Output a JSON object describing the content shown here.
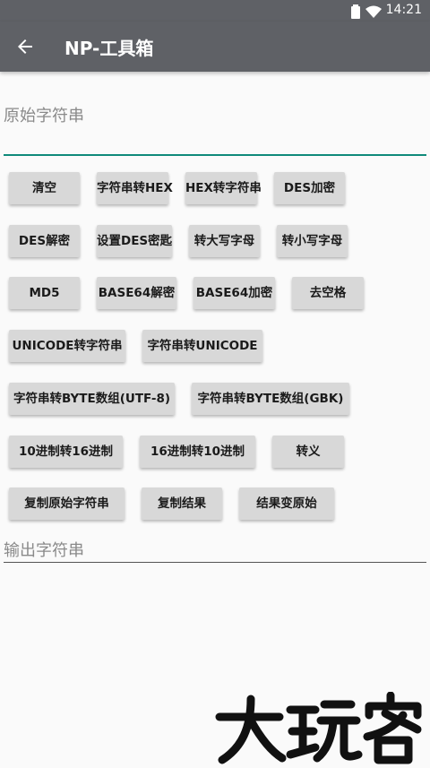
{
  "status_bar": {
    "time": "14:21",
    "icons": [
      "wifi-icon",
      "battery-icon"
    ]
  },
  "app_bar": {
    "title": "NP-工具箱",
    "back_icon": "arrow-back-icon"
  },
  "input": {
    "placeholder": "原始字符串",
    "value": ""
  },
  "buttons": [
    "清空",
    "字符串转HEX",
    "HEX转字符串",
    "DES加密",
    "DES解密",
    "设置DES密匙",
    "转大写字母",
    "转小写字母",
    "MD5",
    "BASE64解密",
    "BASE64加密",
    "去空格",
    "UNICODE转字符串",
    "字符串转UNICODE",
    "字符串转BYTE数组(UTF-8)",
    "字符串转BYTE数组(GBK)",
    "10进制转16进制",
    "16进制转10进制",
    "转义",
    "复制原始字符串",
    "复制结果",
    "结果变原始"
  ],
  "output": {
    "placeholder": "输出字符串"
  },
  "watermark": {
    "text": "大玩客"
  },
  "colors": {
    "app_bar": "#5f6166",
    "accent": "#0f8a7a",
    "button": "#d8d8d8",
    "background": "#fafafa"
  }
}
